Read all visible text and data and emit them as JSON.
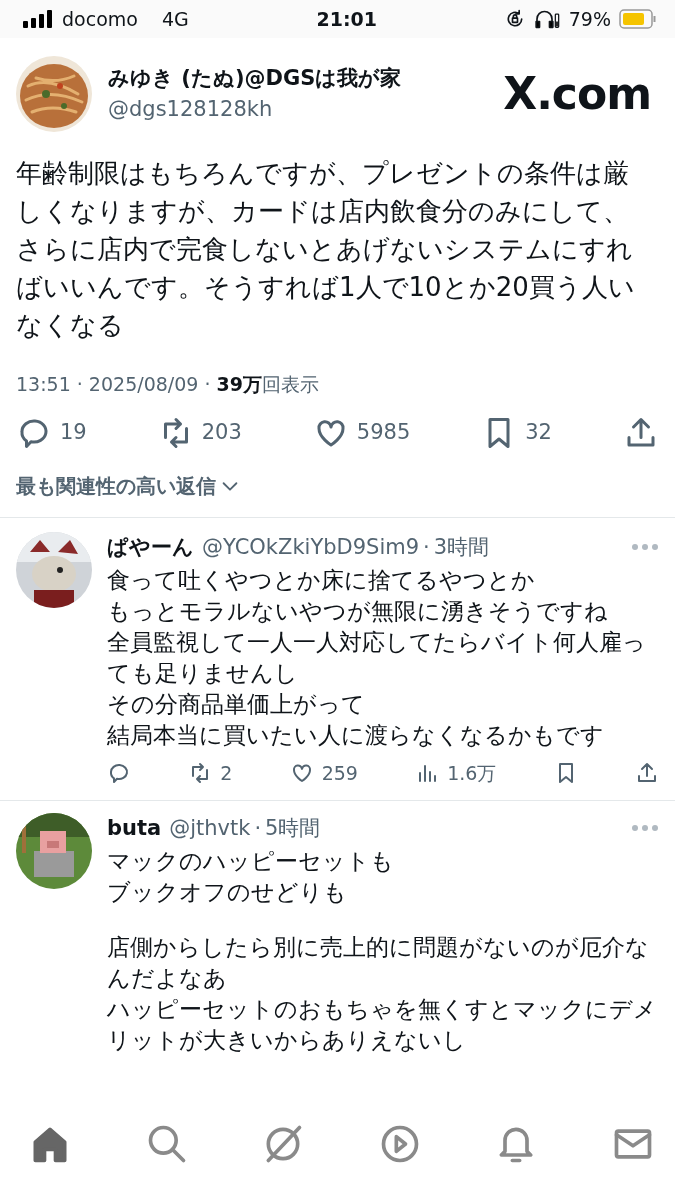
{
  "status_bar": {
    "carrier": "docomo",
    "network": "4G",
    "time": "21:01",
    "battery_percent": "79%"
  },
  "tweet": {
    "author": {
      "name": "みゆき (たぬ)@DGSは我が家",
      "handle": "@dgs128128kh"
    },
    "brand": "X.com",
    "text": "年齢制限はもちろんですが、プレゼントの条件は厳しくなりますが、カードは店内飲食分のみにして、さらに店内で完食しないとあげないシステムにすればいいんです。そうすれば1人で10とか20買う人いなくなる",
    "meta": "13:51 · 2025/08/09 · **39万**回表示",
    "actions": [
      {
        "kind": "reply",
        "count": "19"
      },
      {
        "kind": "repost",
        "count": "203"
      },
      {
        "kind": "like",
        "count": "5985"
      },
      {
        "kind": "bookmark",
        "count": "32"
      },
      {
        "kind": "share"
      }
    ],
    "sort": {
      "label": "最も関連性の高い返信"
    }
  },
  "replies": [
    {
      "name": "ぱやーん",
      "handle": "@YCOkZkiYbD9Sim9",
      "separator": "·",
      "age": "3時間",
      "blocks": [
        [
          "食って吐くやつとか床に捨てるやつとか",
          "もっとモラルないやつが無限に湧きそうですね",
          "全員監視して一人一人対応してたらバイト何人雇っても足りませんし",
          "その分商品単価上がって",
          "結局本当に買いたい人に渡らなくなるかもです"
        ]
      ],
      "actions": [
        {
          "kind": "reply"
        },
        {
          "kind": "repost",
          "count": "2"
        },
        {
          "kind": "like",
          "count": "259"
        },
        {
          "kind": "views",
          "count": "1.6万"
        },
        {
          "kind": "bookmark"
        },
        {
          "kind": "share"
        }
      ]
    },
    {
      "name": "buta",
      "handle": "@jthvtk",
      "separator": "·",
      "age": "5時間",
      "blocks": [
        [
          "マックのハッピーセットも",
          "ブックオフのせどりも"
        ],
        [
          "店側からしたら別に売上的に問題がないのが厄介なんだよなあ",
          "ハッピーセットのおもちゃを無くすとマックにデメリットが大きいからありえないし"
        ]
      ]
    }
  ],
  "tab_bar": [
    {
      "kind": "home",
      "selected": true
    },
    {
      "kind": "search",
      "selected": false
    },
    {
      "kind": "grok",
      "selected": false
    },
    {
      "kind": "play",
      "selected": false
    },
    {
      "kind": "bell",
      "selected": false
    },
    {
      "kind": "mail",
      "selected": false
    }
  ]
}
